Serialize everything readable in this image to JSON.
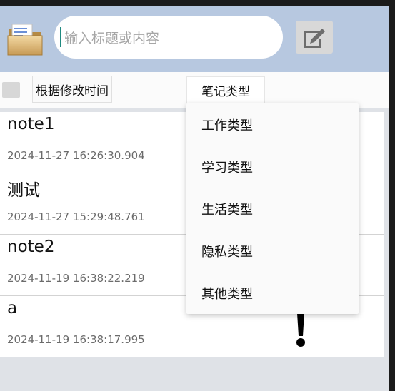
{
  "header": {
    "search": {
      "placeholder": "输入标题或内容"
    }
  },
  "toolbar": {
    "sort_label": "根据修改时间",
    "type_label": "笔记类型"
  },
  "notes": [
    {
      "title": "note1",
      "time": "2024-11-27 16:26:30.904"
    },
    {
      "title": "测试",
      "time": "2024-11-27 15:29:48.761"
    },
    {
      "title": "note2",
      "time": "2024-11-19 16:38:22.219"
    },
    {
      "title": "a",
      "time": "2024-11-19 16:38:17.995"
    }
  ],
  "dropdown": {
    "options": [
      "工作类型",
      "学习类型",
      "生活类型",
      "隐私类型",
      "其他类型"
    ]
  },
  "icons": {
    "folder": "folder-icon",
    "edit": "edit-note-icon",
    "exclamation": "exclamation-icon"
  },
  "colors": {
    "header_bg": "#b7c8e0",
    "cursor": "#1f8a80"
  }
}
